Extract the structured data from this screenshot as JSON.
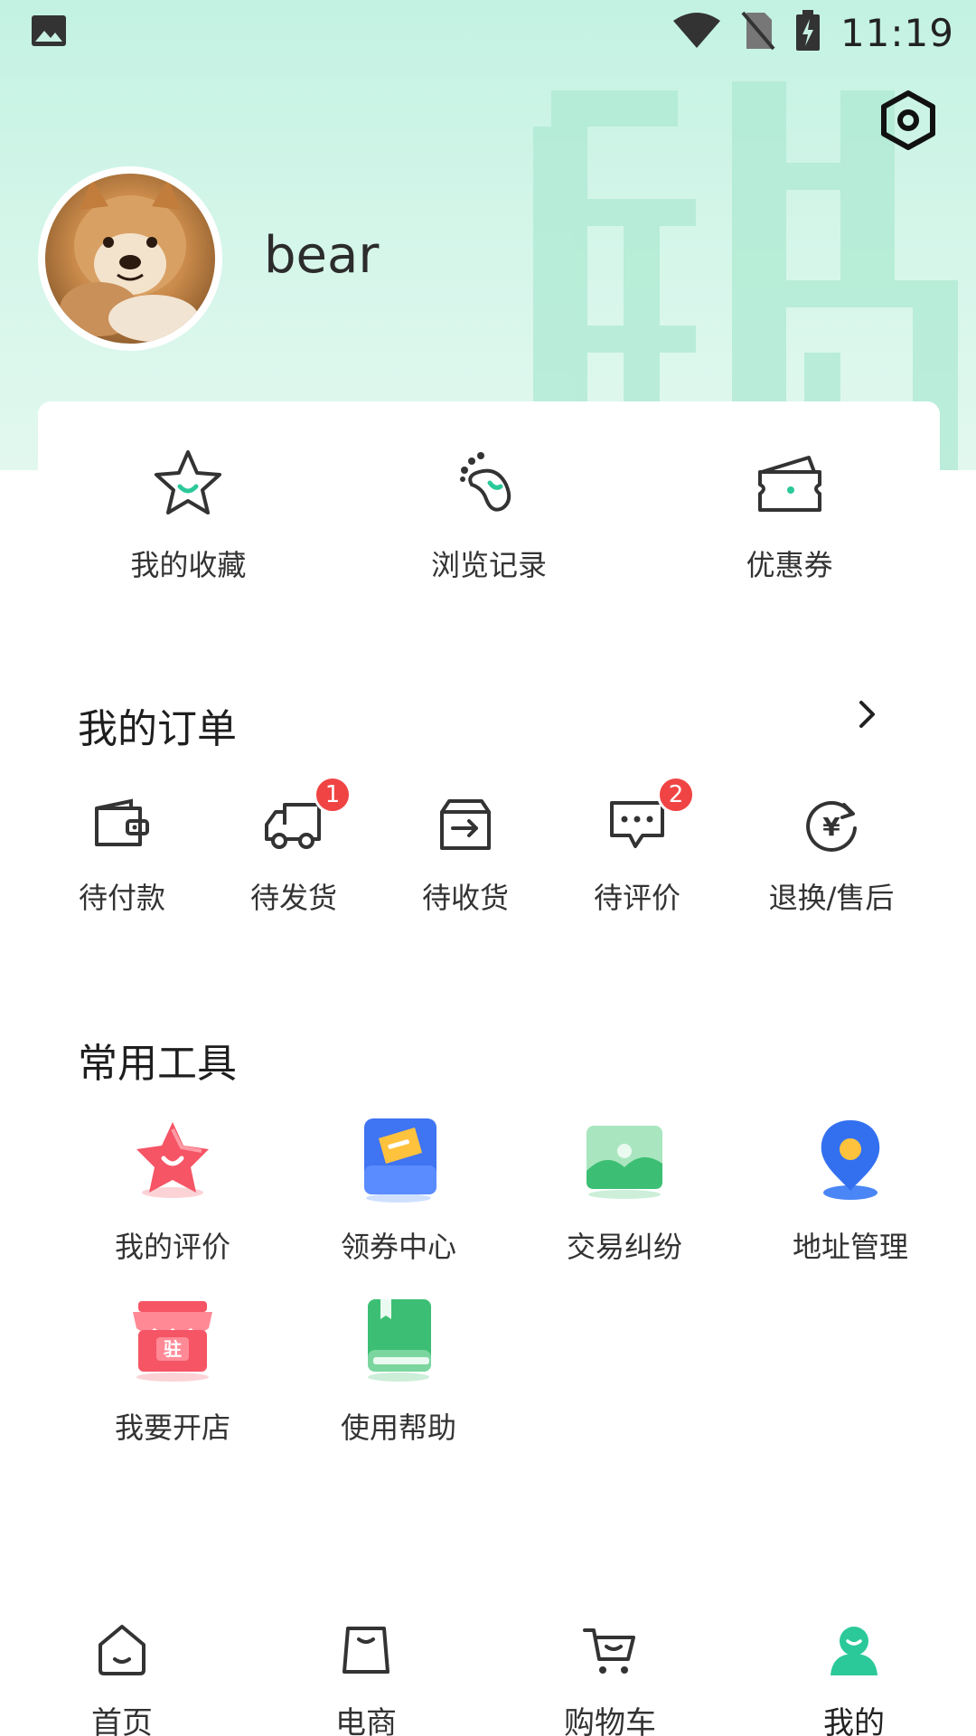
{
  "status_bar": {
    "time": "11:19",
    "icons": [
      "image-icon",
      "wifi-icon",
      "no-sim-icon",
      "battery-charging-icon"
    ]
  },
  "profile": {
    "username": "bear"
  },
  "quick_links": [
    {
      "label": "我的收藏",
      "icon": "star-icon"
    },
    {
      "label": "浏览记录",
      "icon": "footprint-icon"
    },
    {
      "label": "优惠券",
      "icon": "coupon-icon"
    }
  ],
  "orders": {
    "title": "我的订单",
    "items": [
      {
        "label": "待付款",
        "icon": "wallet-icon",
        "badge": ""
      },
      {
        "label": "待发货",
        "icon": "truck-icon",
        "badge": "1"
      },
      {
        "label": "待收货",
        "icon": "inbox-icon",
        "badge": ""
      },
      {
        "label": "待评价",
        "icon": "comment-icon",
        "badge": "2"
      },
      {
        "label": "退换/售后",
        "icon": "refund-icon",
        "badge": ""
      }
    ]
  },
  "tools": {
    "title": "常用工具",
    "items": [
      {
        "label": "我的评价",
        "icon": "review-star-icon"
      },
      {
        "label": "领券中心",
        "icon": "coupon-center-icon"
      },
      {
        "label": "交易纠纷",
        "icon": "dispute-icon"
      },
      {
        "label": "地址管理",
        "icon": "location-icon"
      },
      {
        "label": "我要开店",
        "icon": "shop-icon",
        "badge_text": "驻"
      },
      {
        "label": "使用帮助",
        "icon": "help-book-icon"
      }
    ]
  },
  "bottom_nav": {
    "items": [
      {
        "label": "首页",
        "icon": "home-icon"
      },
      {
        "label": "电商",
        "icon": "shopping-bag-icon"
      },
      {
        "label": "购物车",
        "icon": "cart-icon"
      },
      {
        "label": "我的",
        "icon": "profile-icon"
      }
    ],
    "active": "我的"
  },
  "colors": {
    "accent": "#2bc99a",
    "badge": "#f04444",
    "hero_bg": "#c3f2e2"
  }
}
